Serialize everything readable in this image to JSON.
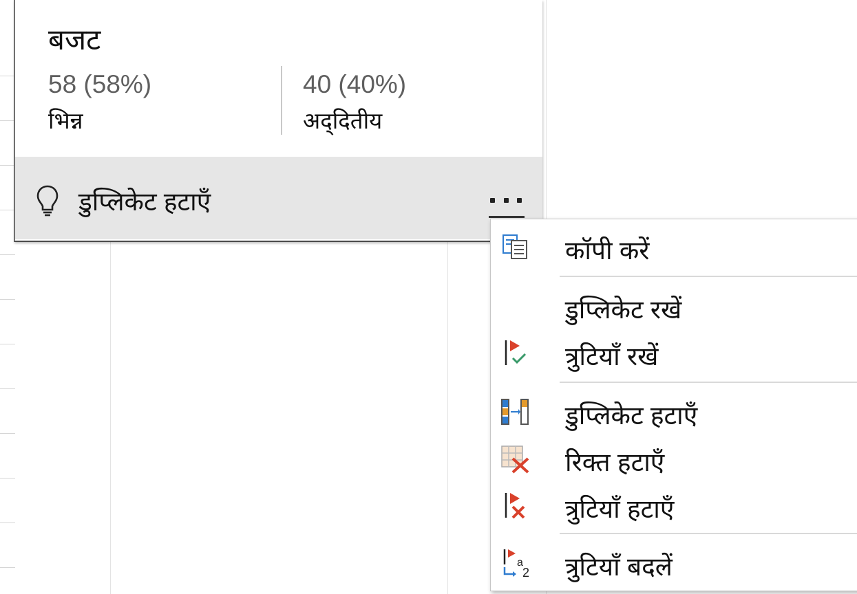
{
  "card": {
    "title": "बजट",
    "stats": [
      {
        "value": "58 (58%)",
        "label": "भिन्न"
      },
      {
        "value": "40 (40%)",
        "label": "अद्‌दितीय"
      }
    ],
    "action": {
      "icon": "lightbulb-icon",
      "label": "डुप्लिकेट हटाएँ",
      "more_icon": "more-options-icon"
    }
  },
  "menu": {
    "items": [
      {
        "label": "कॉपी करें",
        "icon": "copy-icon"
      },
      {
        "label": "डुप्लिकेट रखें",
        "icon": ""
      },
      {
        "label": "त्रुटियाँ रखें",
        "icon": "keep-errors-icon"
      },
      {
        "label": "डुप्लिकेट हटाएँ",
        "icon": "remove-duplicates-icon"
      },
      {
        "label": "रिक्त हटाएँ",
        "icon": "remove-empty-icon"
      },
      {
        "label": "त्रुटियाँ हटाएँ",
        "icon": "remove-errors-icon"
      },
      {
        "label": "त्रुटियाँ बदलें",
        "icon": "replace-errors-icon"
      }
    ]
  },
  "colors": {
    "accent_red": "#d9412b",
    "accent_green": "#3a9a6a",
    "accent_blue": "#2f7ccf",
    "accent_orange": "#e39a2d",
    "action_bar_bg": "#e6e6e6"
  }
}
